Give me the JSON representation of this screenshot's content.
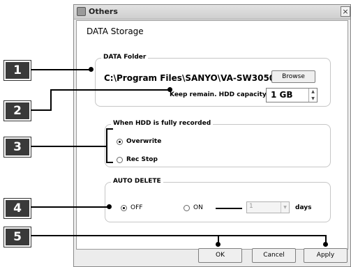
{
  "window": {
    "title": "Others",
    "close_glyph": "×"
  },
  "header": {
    "title": "DATA Storage"
  },
  "data_folder": {
    "legend": "DATA Folder",
    "path": "C:\\Program Files\\SANYO\\VA-SW3050",
    "browse_label": "Browse",
    "keep_label": "Keep remain. HDD capacity",
    "keep_value": "1 GB"
  },
  "hdd_full": {
    "legend": "When HDD is fully recorded",
    "options": [
      {
        "label": "Overwrite",
        "selected": true
      },
      {
        "label": "Rec Stop",
        "selected": false
      }
    ]
  },
  "auto_delete": {
    "legend": "AUTO DELETE",
    "off_label": "OFF",
    "on_label": "ON",
    "selected": "OFF",
    "days_value": "1",
    "days_label": "days"
  },
  "footer": {
    "ok_label": "OK",
    "cancel_label": "Cancel",
    "apply_label": "Apply"
  },
  "callouts": [
    "1",
    "2",
    "3",
    "4",
    "5"
  ],
  "colors": {
    "badge": "#3a3a3a",
    "window_bg": "#ececec"
  }
}
